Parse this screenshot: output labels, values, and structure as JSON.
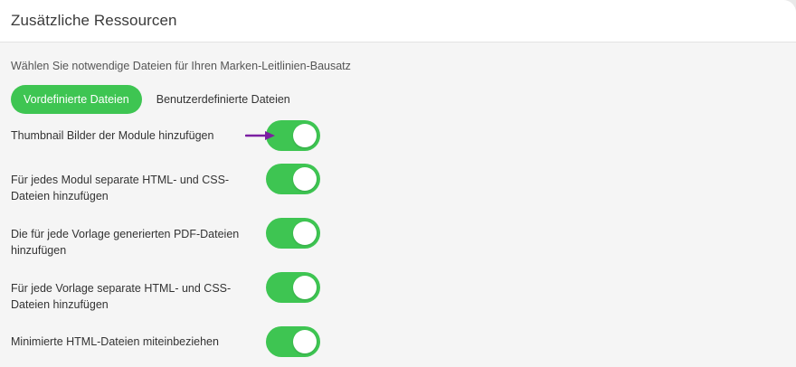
{
  "panel": {
    "title": "Zusätzliche Ressourcen",
    "subtitle": "Wählen Sie notwendige Dateien für Ihren Marken-Leitlinien-Bausatz"
  },
  "tabs": [
    {
      "label": "Vordefinierte Dateien",
      "active": true
    },
    {
      "label": "Benutzerdefinierte Dateien",
      "active": false
    }
  ],
  "options": [
    {
      "label": "Thumbnail Bilder der Module hinzufügen",
      "enabled": true
    },
    {
      "label": "Für jedes Modul separate HTML- und CSS-Dateien hinzufügen",
      "enabled": true
    },
    {
      "label": "Die für jede Vorlage generierten PDF-Dateien hinzufügen",
      "enabled": true
    },
    {
      "label": "Für jede Vorlage separate HTML- und CSS-Dateien hinzufügen",
      "enabled": true
    },
    {
      "label": "Minimierte HTML-Dateien miteinbeziehen",
      "enabled": true
    }
  ],
  "colors": {
    "accent": "#3ec552",
    "arrow": "#7b1fa2"
  },
  "icons": {
    "annotation": "arrow-right-icon"
  }
}
